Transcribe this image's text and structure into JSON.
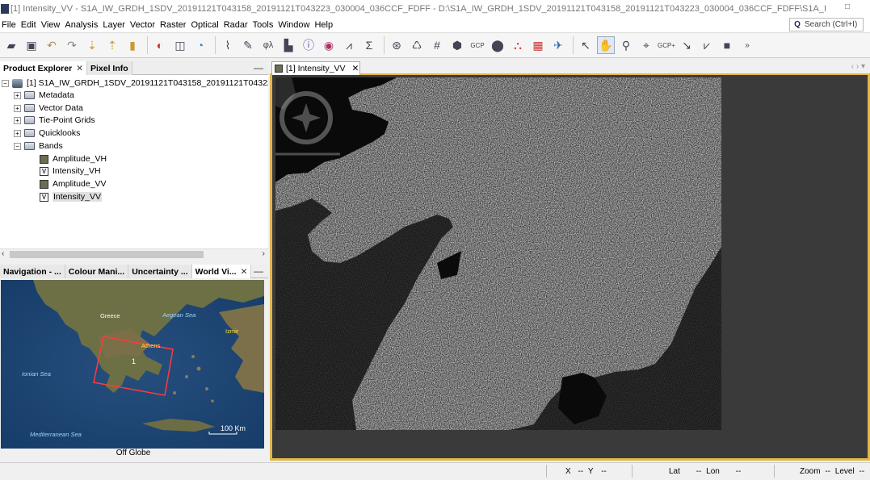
{
  "window": {
    "title": "[1] Intensity_VV - S1A_IW_GRDH_1SDV_20191121T043158_20191121T043223_030004_036CCF_FDFF - D:\\S1A_IW_GRDH_1SDV_20191121T043158_20191121T043223_030004_036CCF_FDFF\\S1A_IW_GRDH_1SDV_20..."
  },
  "menu": [
    "File",
    "Edit",
    "View",
    "Analysis",
    "Layer",
    "Vector",
    "Raster",
    "Optical",
    "Radar",
    "Tools",
    "Window",
    "Help"
  ],
  "search": {
    "placeholder": "Search (Ctrl+I)"
  },
  "product_explorer": {
    "tabs": [
      {
        "label": "Product Explorer",
        "closable": true,
        "active": true
      },
      {
        "label": "Pixel Info",
        "closable": false,
        "active": false
      }
    ],
    "product": "[1] S1A_IW_GRDH_1SDV_20191121T043158_20191121T043223_030",
    "nodes": [
      "Metadata",
      "Vector Data",
      "Tie-Point Grids",
      "Quicklooks",
      "Bands"
    ],
    "bands": [
      {
        "name": "Amplitude_VH",
        "type": "amp"
      },
      {
        "name": "Intensity_VH",
        "type": "int"
      },
      {
        "name": "Amplitude_VV",
        "type": "amp"
      },
      {
        "name": "Intensity_VV",
        "type": "int",
        "selected": true
      }
    ]
  },
  "bottom_panel": {
    "tabs": [
      "Navigation - ...",
      "Colour Mani...",
      "Uncertainty ...",
      "World Vi..."
    ],
    "map_labels": {
      "greece": "Greece",
      "aegean": "Aegean Sea",
      "izmir": "Izmir",
      "athens": "Athens",
      "ionian": "Ionian Sea",
      "mediterranean": "Mediterranean Sea",
      "product_number": "1",
      "scale": "100 Km"
    },
    "footer": "Off Globe"
  },
  "image_view": {
    "tab_label": "[1] Intensity_VV"
  },
  "status": {
    "x_label": "X",
    "x_value": "--",
    "y_label": "Y",
    "y_value": "--",
    "lat_label": "Lat",
    "lat_value": "--",
    "lon_label": "Lon",
    "lon_value": "--",
    "zoom_label": "Zoom",
    "zoom_value": "--",
    "level_label": "Level",
    "level_value": "--"
  },
  "colors": {
    "accent": "#e2b64a",
    "selection": "#dfe8f4"
  }
}
